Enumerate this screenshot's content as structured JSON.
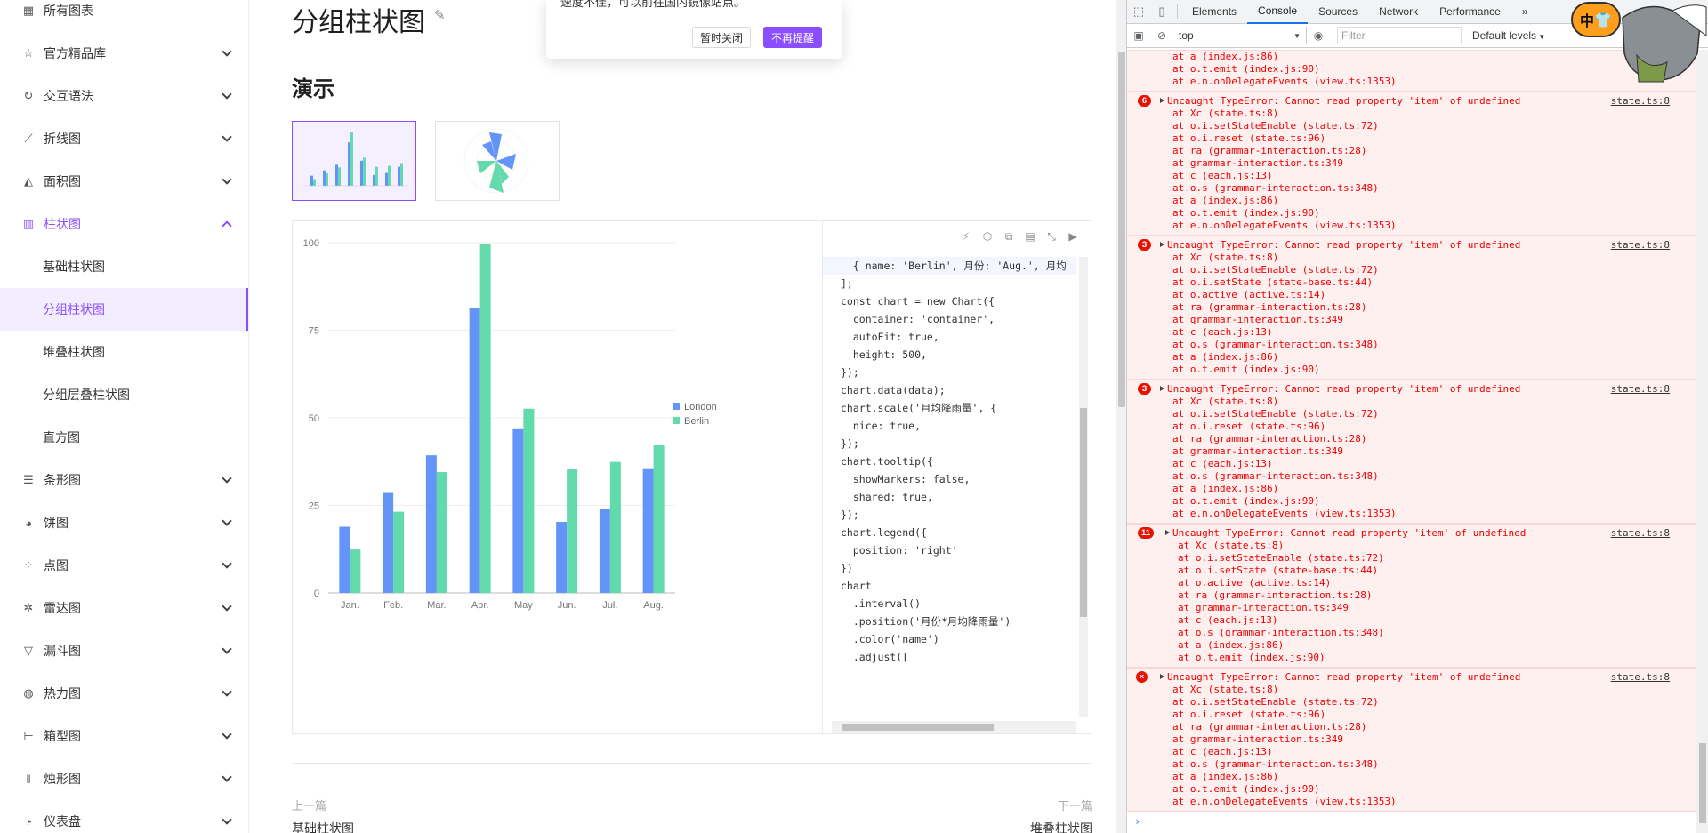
{
  "sidebar": {
    "items": [
      {
        "label": "所有图表",
        "icon": "grid-icon",
        "icon_char": "▦",
        "expandable": false
      },
      {
        "label": "官方精品库",
        "icon": "star-icon",
        "icon_char": "☆",
        "expandable": true
      },
      {
        "label": "交互语法",
        "icon": "cycle-icon",
        "icon_char": "↻",
        "expandable": true
      },
      {
        "label": "折线图",
        "icon": "line-chart-icon",
        "icon_char": "⟋",
        "expandable": true
      },
      {
        "label": "面积图",
        "icon": "area-chart-icon",
        "icon_char": "◭",
        "expandable": true
      }
    ],
    "active_group": {
      "label": "柱状图",
      "icon": "bar-chart-icon",
      "icon_char": "▥"
    },
    "sub_items": [
      "基础柱状图",
      "分组柱状图",
      "堆叠柱状图",
      "分组层叠柱状图",
      "直方图"
    ],
    "selected_sub": "分组柱状图",
    "items_after": [
      {
        "label": "条形图",
        "icon": "bar-horizontal-icon",
        "icon_char": "☰"
      },
      {
        "label": "饼图",
        "icon": "pie-chart-icon",
        "icon_char": "◕"
      },
      {
        "label": "点图",
        "icon": "scatter-icon",
        "icon_char": "⁘"
      },
      {
        "label": "雷达图",
        "icon": "radar-icon",
        "icon_char": "✲"
      },
      {
        "label": "漏斗图",
        "icon": "funnel-icon",
        "icon_char": "▽"
      },
      {
        "label": "热力图",
        "icon": "heatmap-icon",
        "icon_char": "◍"
      },
      {
        "label": "箱型图",
        "icon": "boxplot-icon",
        "icon_char": "⊢"
      },
      {
        "label": "烛形图",
        "icon": "candlestick-icon",
        "icon_char": "ǁ"
      },
      {
        "label": "仪表盘",
        "icon": "gauge-icon",
        "icon_char": "◔"
      }
    ]
  },
  "main": {
    "title": "分组柱状图",
    "section": "演示",
    "prev_label": "上一篇",
    "prev_link": "基础柱状图",
    "next_label": "下一篇",
    "next_link": "堆叠柱状图"
  },
  "popup": {
    "text": "速度不佳，可以前往国内镜像站点。",
    "close_button": "暂时关闭",
    "dismiss_button": "不再提醒"
  },
  "colors": {
    "accent": "#8a4dff",
    "london": "#6395f9",
    "berlin": "#62daab",
    "error": "#e51400"
  },
  "chart_data": {
    "type": "bar",
    "categories": [
      "Jan.",
      "Feb.",
      "Mar.",
      "Apr.",
      "May",
      "Jun.",
      "Jul.",
      "Aug."
    ],
    "series": [
      {
        "name": "London",
        "values": [
          18.9,
          28.8,
          39.3,
          81.4,
          47,
          20.3,
          24,
          35.6
        ]
      },
      {
        "name": "Berlin",
        "values": [
          12.4,
          23.2,
          34.5,
          99.7,
          52.6,
          35.5,
          37.4,
          42.4
        ]
      }
    ],
    "y_ticks": [
      "0",
      "25",
      "50",
      "75",
      "100"
    ],
    "ylim": [
      0,
      100
    ],
    "legend_position": "right",
    "grid": true
  },
  "code": {
    "lines": [
      "  { name: 'Berlin', 月份: 'Aug.', 月均",
      "];",
      "",
      "const chart = new Chart({",
      "  container: 'container',",
      "  autoFit: true,",
      "  height: 500,",
      "});",
      "",
      "chart.data(data);",
      "chart.scale('月均降雨量', {",
      "  nice: true,",
      "});",
      "chart.tooltip({",
      "  showMarkers: false,",
      "  shared: true,",
      "});",
      "chart.legend({",
      "  position: 'right'",
      "})",
      "",
      "chart",
      "  .interval()",
      "  .position('月份*月均降雨量')",
      "  .color('name')",
      "  .adjust(["
    ]
  },
  "devtools": {
    "tabs": [
      "Elements",
      "Console",
      "Sources",
      "Network",
      "Performance"
    ],
    "active_tab": "Console",
    "more": "»",
    "context": "top",
    "filter_placeholder": "Filter",
    "levels": "Default levels",
    "ext_label": "中",
    "prompt": "›",
    "top_frames": [
      "at a (index.js:86)",
      "at o.t.emit (index.js:90)",
      "at e.n.onDelegateEvents (view.ts:1353)"
    ],
    "errors": [
      {
        "count": "6",
        "message": "Uncaught TypeError: Cannot read property 'item' of undefined",
        "source": "state.ts:8",
        "frames": [
          "at Xc (state.ts:8)",
          "at o.i.setStateEnable (state.ts:72)",
          "at o.i.reset (state.ts:96)",
          "at ra (grammar-interaction.ts:28)",
          "at grammar-interaction.ts:349",
          "at c (each.js:13)",
          "at o.s (grammar-interaction.ts:348)",
          "at a (index.js:86)",
          "at o.t.emit (index.js:90)",
          "at e.n.onDelegateEvents (view.ts:1353)"
        ]
      },
      {
        "count": "3",
        "message": "Uncaught TypeError: Cannot read property 'item' of undefined",
        "source": "state.ts:8",
        "frames": [
          "at Xc (state.ts:8)",
          "at o.i.setStateEnable (state.ts:72)",
          "at o.i.setState (state-base.ts:44)",
          "at o.active (active.ts:14)",
          "at ra (grammar-interaction.ts:28)",
          "at grammar-interaction.ts:349",
          "at c (each.js:13)",
          "at o.s (grammar-interaction.ts:348)",
          "at a (index.js:86)",
          "at o.t.emit (index.js:90)"
        ]
      },
      {
        "count": "3",
        "message": "Uncaught TypeError: Cannot read property 'item' of undefined",
        "source": "state.ts:8",
        "frames": [
          "at Xc (state.ts:8)",
          "at o.i.setStateEnable (state.ts:72)",
          "at o.i.reset (state.ts:96)",
          "at ra (grammar-interaction.ts:28)",
          "at grammar-interaction.ts:349",
          "at c (each.js:13)",
          "at o.s (grammar-interaction.ts:348)",
          "at a (index.js:86)",
          "at o.t.emit (index.js:90)",
          "at e.n.onDelegateEvents (view.ts:1353)"
        ]
      },
      {
        "count": "11",
        "message": "Uncaught TypeError: Cannot read property 'item' of undefined",
        "source": "state.ts:8",
        "frames": [
          "at Xc (state.ts:8)",
          "at o.i.setStateEnable (state.ts:72)",
          "at o.i.setState (state-base.ts:44)",
          "at o.active (active.ts:14)",
          "at ra (grammar-interaction.ts:28)",
          "at grammar-interaction.ts:349",
          "at c (each.js:13)",
          "at o.s (grammar-interaction.ts:348)",
          "at a (index.js:86)",
          "at o.t.emit (index.js:90)"
        ]
      },
      {
        "count": "×",
        "message": "Uncaught TypeError: Cannot read property 'item' of undefined",
        "source": "state.ts:8",
        "frames": [
          "at Xc (state.ts:8)",
          "at o.i.setStateEnable (state.ts:72)",
          "at o.i.reset (state.ts:96)",
          "at ra (grammar-interaction.ts:28)",
          "at grammar-interaction.ts:349",
          "at c (each.js:13)",
          "at o.s (grammar-interaction.ts:348)",
          "at a (index.js:86)",
          "at o.t.emit (index.js:90)",
          "at e.n.onDelegateEvents (view.ts:1353)"
        ]
      }
    ]
  }
}
